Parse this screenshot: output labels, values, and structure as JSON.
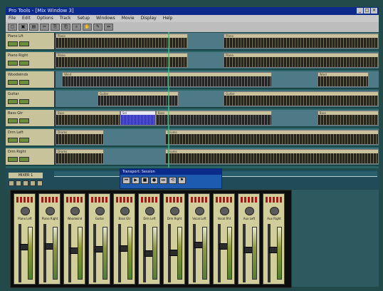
{
  "window": {
    "title": "Pro Tools - [Mix Window 3]"
  },
  "menu": [
    "File",
    "Edit",
    "Options",
    "Track",
    "Setup",
    "Windows",
    "Movie",
    "Display",
    "Help"
  ],
  "toolbar_icons": [
    "new-icon",
    "open-icon",
    "save-icon",
    "cut-icon",
    "copy-icon",
    "paste-icon",
    "zoom-icon",
    "grabber-icon",
    "pencil-icon",
    "trim-icon"
  ],
  "tracks": [
    {
      "name": "Piano Lft",
      "clips": [
        {
          "label": "Piano",
          "start": 0,
          "end": 0.41
        },
        {
          "label": "Piano",
          "start": 0.52,
          "end": 1.0
        }
      ]
    },
    {
      "name": "Piano Right",
      "clips": [
        {
          "label": "Piano",
          "start": 0,
          "end": 0.41
        },
        {
          "label": "Piano",
          "start": 0.52,
          "end": 1.0
        }
      ]
    },
    {
      "name": "Woodwinds",
      "clips": [
        {
          "label": "Wind",
          "start": 0.02,
          "end": 0.67
        },
        {
          "label": "Wind",
          "start": 0.81,
          "end": 0.97
        }
      ]
    },
    {
      "name": "Guitar",
      "clips": [
        {
          "label": "Guitar",
          "start": 0.13,
          "end": 0.38
        },
        {
          "label": "Guitar",
          "start": 0.52,
          "end": 1.0
        }
      ]
    },
    {
      "name": "Bass Gtr",
      "clips": [
        {
          "label": "Bass",
          "start": 0,
          "end": 0.2
        },
        {
          "label": "Sel",
          "start": 0.2,
          "end": 0.31,
          "selected": true
        },
        {
          "label": "Bass",
          "start": 0.31,
          "end": 0.67
        },
        {
          "label": "Bass",
          "start": 0.81,
          "end": 1.0
        }
      ]
    },
    {
      "name": "Drm Left",
      "clips": [
        {
          "label": "Drums",
          "start": 0,
          "end": 0.15
        },
        {
          "label": "Drums",
          "start": 0.34,
          "end": 1.0
        }
      ]
    },
    {
      "name": "Drm Right",
      "clips": [
        {
          "label": "Drums",
          "start": 0,
          "end": 0.15
        },
        {
          "label": "Drums",
          "start": 0.34,
          "end": 1.0
        }
      ]
    }
  ],
  "mixer_panel": {
    "label": "MIXER 1",
    "buttons": [
      "mute-icon",
      "solo-icon",
      "rec-icon",
      "play-icon",
      "loop-icon"
    ]
  },
  "transport": {
    "title": "Transport: Session",
    "controls": [
      "rewind-icon",
      "play-icon",
      "stop-icon",
      "record-icon",
      "ffwd-icon",
      "loop-icon",
      "marker-icon"
    ]
  },
  "channels": [
    {
      "name": "Piano Left",
      "fader": 0.62,
      "meter": 0.7
    },
    {
      "name": "Piano Right",
      "fader": 0.64,
      "meter": 0.72
    },
    {
      "name": "Woodwind",
      "fader": 0.55,
      "meter": 0.5
    },
    {
      "name": "Guitar",
      "fader": 0.58,
      "meter": 0.45
    },
    {
      "name": "Bass Gtr",
      "fader": 0.6,
      "meter": 0.6
    },
    {
      "name": "Drm Left",
      "fader": 0.5,
      "meter": 0.62
    },
    {
      "name": "Drm Right",
      "fader": 0.52,
      "meter": 0.64
    },
    {
      "name": "Vocal Left",
      "fader": 0.66,
      "meter": 0.4
    },
    {
      "name": "Vocal Rht",
      "fader": 0.63,
      "meter": 0.42
    },
    {
      "name": "Aux Left",
      "fader": 0.57,
      "meter": 0.55
    },
    {
      "name": "Aux Right",
      "fader": 0.57,
      "meter": 0.55
    }
  ]
}
